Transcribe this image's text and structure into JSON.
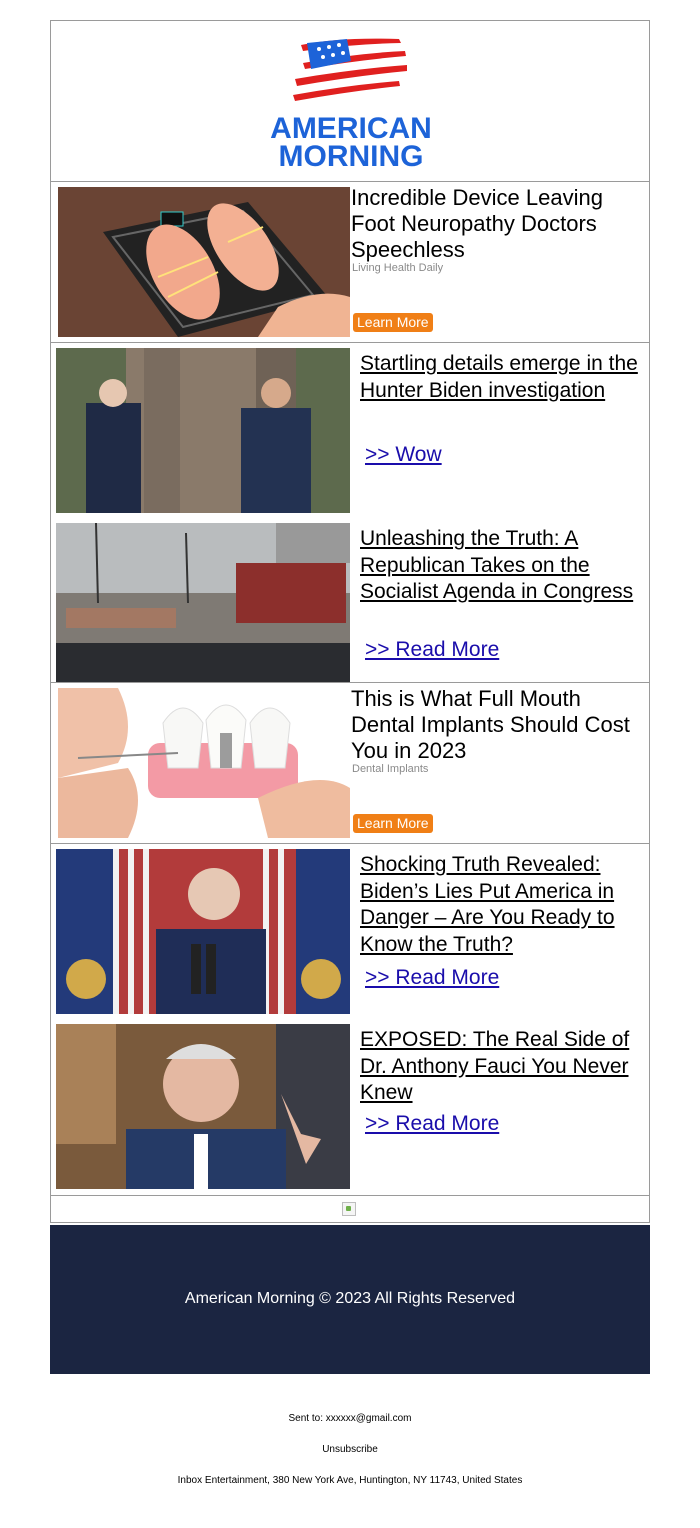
{
  "logo": {
    "line1": "AMERICAN",
    "line2": "MORNING",
    "colors": {
      "blue": "#1d63d8",
      "red": "#e0201f"
    }
  },
  "ads": [
    {
      "title": "Incredible Device Leaving Foot Neuropathy Doctors Speechless",
      "source": "Living Health Daily",
      "cta": "Learn More",
      "image": "foot-massager-mat-image"
    },
    {
      "title": "This is What Full Mouth Dental Implants Should Cost You in 2023",
      "source": "Dental Implants",
      "cta": "Learn More",
      "image": "dental-implant-model-image"
    }
  ],
  "stories_group1": [
    {
      "headline": "Startling details emerge in the Hunter Biden investigation",
      "link": ">> Wow",
      "image": "two-men-outside-house-image"
    },
    {
      "headline": "Unleashing the Truth: A Republican Takes on the Socialist Agenda in Congress",
      "link": ">> Read More",
      "image": "street-debris-image"
    }
  ],
  "stories_group2": [
    {
      "headline": "Shocking Truth Revealed: Biden’s Lies Put America in Danger – Are You Ready to Know the Truth?",
      "link": ">> Read More",
      "image": "speaker-at-podium-flags-image"
    },
    {
      "headline": "EXPOSED: The Real Side of Dr. Anthony Fauci You Never Knew",
      "link": ">> Read More",
      "image": "man-gesturing-at-hearing-image"
    }
  ],
  "footer": {
    "copyright": "American Morning © 2023 All Rights Reserved",
    "background": "#1b2541"
  },
  "meta": {
    "sent_to": "Sent to: xxxxxx@gmail.com",
    "unsubscribe": "Unsubscribe",
    "address": "Inbox Entertainment, 380 New York Ave, Huntington, NY 11743, United States"
  }
}
